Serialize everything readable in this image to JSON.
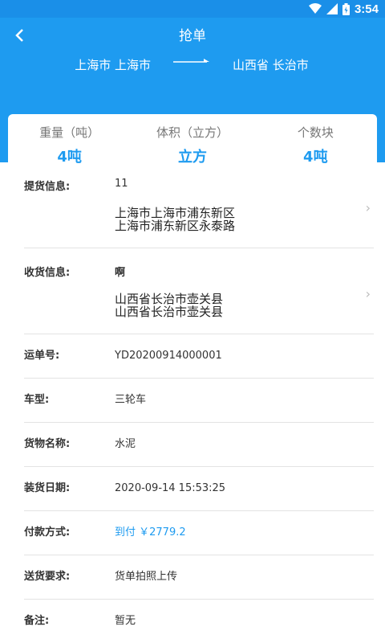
{
  "status_bar": {
    "time": "3:54"
  },
  "header": {
    "title": "抢单",
    "route_from": "上海市 上海市",
    "route_to": "山西省 长治市"
  },
  "stats": [
    {
      "label": "重量（吨）",
      "value": "4吨"
    },
    {
      "label": "体积（立方）",
      "value": "立方"
    },
    {
      "label": "个数块",
      "value": "4吨"
    }
  ],
  "pickup": {
    "label": "提货信息:",
    "name": "11",
    "address_line1": "上海市上海市浦东新区",
    "address_line2": "上海市浦东新区永泰路"
  },
  "delivery": {
    "label": "收货信息:",
    "name": "啊",
    "address_line1": "山西省长治市壶关县",
    "address_line2": "山西省长治市壶关县"
  },
  "fields": {
    "waybill_label": "运单号:",
    "waybill_value": "YD20200914000001",
    "vehicle_label": "车型:",
    "vehicle_value": "三轮车",
    "cargo_label": "货物名称:",
    "cargo_value": "水泥",
    "load_date_label": "装货日期:",
    "load_date_value": "2020-09-14 15:53:25",
    "payment_label": "付款方式:",
    "payment_value": "到付 ￥2779.2",
    "delivery_req_label": "送货要求:",
    "delivery_req_value": "货单拍照上传",
    "remark_label": "备注:",
    "remark_value": "暂无"
  },
  "colors": {
    "primary": "#1e9bf0",
    "status_bar": "#1a8fe8"
  }
}
